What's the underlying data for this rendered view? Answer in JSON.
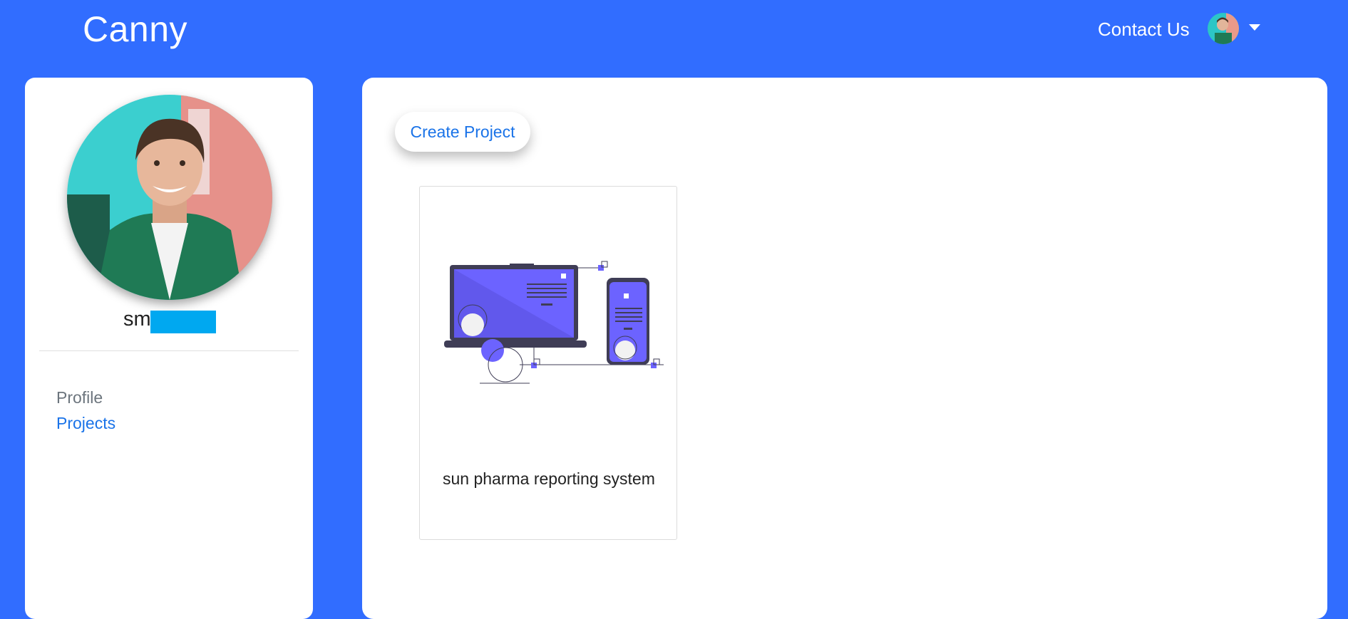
{
  "header": {
    "brand": "Canny",
    "contact_label": "Contact Us"
  },
  "sidebar": {
    "username_visible": "sm",
    "nav": {
      "profile_label": "Profile",
      "projects_label": "Projects"
    }
  },
  "main": {
    "create_button_label": "Create Project",
    "projects": [
      {
        "name": "sun pharma reporting system"
      }
    ]
  },
  "colors": {
    "background": "#316dff",
    "link": "#1a73e8",
    "illustration": "#6c63ff",
    "redaction": "#00a8f0"
  }
}
